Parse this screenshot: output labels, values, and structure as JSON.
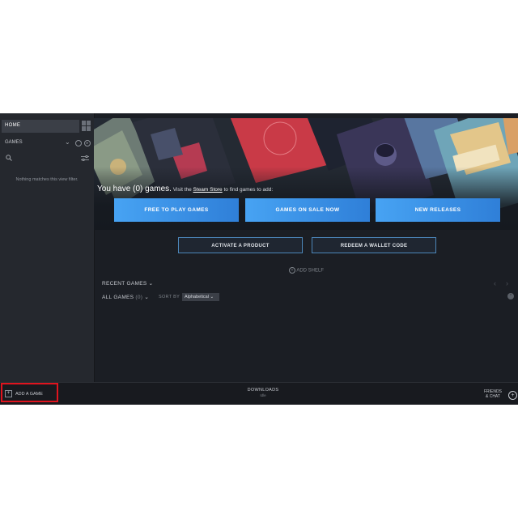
{
  "sidebar": {
    "home_label": "HOME",
    "games_label": "GAMES",
    "empty_message": "Nothing matches this view filter."
  },
  "hero": {
    "headline": "You have (0) games.",
    "visit_prefix": " Visit the ",
    "store_link": "Steam Store",
    "visit_suffix": " to find games to add:",
    "buttons": [
      "FREE TO PLAY GAMES",
      "GAMES ON SALE NOW",
      "NEW RELEASES"
    ]
  },
  "actions": {
    "activate": "ACTIVATE A PRODUCT",
    "redeem": "REDEEM A WALLET CODE"
  },
  "library": {
    "add_shelf": "ADD SHELF",
    "recent_games": "RECENT GAMES",
    "all_games": "ALL GAMES",
    "all_games_count": "(0)",
    "sort_by": "SORT BY",
    "sort_value": "Alphabetical"
  },
  "bottombar": {
    "add_game": "ADD A GAME",
    "downloads": "DOWNLOADS",
    "downloads_status": "Idle",
    "friends_line1": "FRIENDS",
    "friends_line2": "& CHAT"
  },
  "colors": {
    "accent_blue": "#47a3f3",
    "highlight_red": "#e0141e",
    "background": "#1b1e24"
  }
}
